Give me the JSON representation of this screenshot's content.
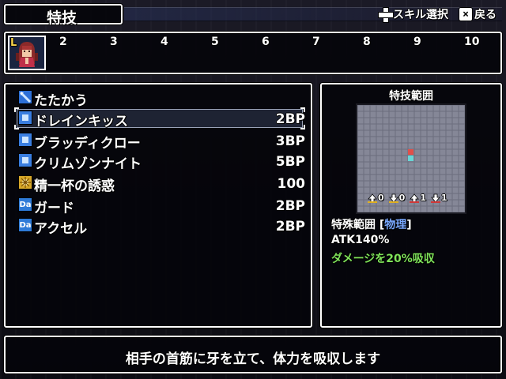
{
  "header": {
    "title": "特技",
    "skill_select_label": "スキル選択",
    "back_label": "戻る",
    "back_button_glyph": "×"
  },
  "party": {
    "selected_badge": "L",
    "slots": [
      "2",
      "3",
      "4",
      "5",
      "6",
      "7",
      "8",
      "9",
      "10"
    ]
  },
  "skills": [
    {
      "name": "たたかう",
      "cost": "",
      "icon": "sword-icon"
    },
    {
      "name": "ドレインキッス",
      "cost": "2BP",
      "icon": "blue-square-icon"
    },
    {
      "name": "ブラッディクロー",
      "cost": "3BP",
      "icon": "blue-square-icon"
    },
    {
      "name": "クリムゾンナイト",
      "cost": "5BP",
      "icon": "blue-square-icon"
    },
    {
      "name": "精一杯の誘惑",
      "cost": "100",
      "icon": "gold-burst-icon"
    },
    {
      "name": "ガード",
      "cost": "2BP",
      "icon": "da-icon",
      "icon_text": "Da"
    },
    {
      "name": "アクセル",
      "cost": "2BP",
      "icon": "da-icon",
      "icon_text": "Da"
    }
  ],
  "selected_index": 1,
  "range": {
    "title": "特技範囲",
    "stats": [
      {
        "icon": "up-arrow-yellow-icon",
        "value": "0"
      },
      {
        "icon": "down-arrow-yellow-icon",
        "value": "0"
      },
      {
        "icon": "up-arrow-red-icon",
        "value": "1"
      },
      {
        "icon": "down-arrow-red-icon",
        "value": "1"
      }
    ],
    "range_type": "特殊範囲",
    "bracket_open": "[",
    "element": "物理",
    "bracket_close": "]",
    "atk": "ATK140%",
    "effect": "ダメージを20%吸収"
  },
  "description": "相手の首筋に牙を立て、体力を吸収します",
  "colors": {
    "effect_green": "#7fe35a",
    "element_blue": "#79a8ff",
    "target_red": "#e0504a",
    "target_cyan": "#68d6d6"
  }
}
